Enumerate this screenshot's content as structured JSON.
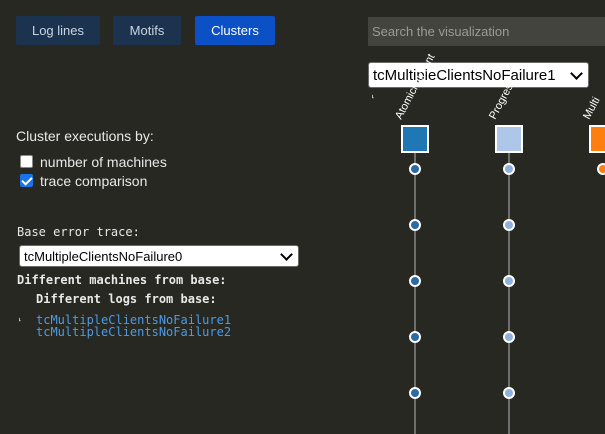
{
  "tabs": [
    {
      "label": "Log lines"
    },
    {
      "label": "Motifs"
    },
    {
      "label": "Clusters"
    }
  ],
  "search": {
    "placeholder": "Search the visualization"
  },
  "viz": {
    "trace_select": "tcMultipleClientsNoFailure1",
    "columns": [
      {
        "label": "AtomicityIntent",
        "color": "#1f77b4",
        "dots": 5
      },
      {
        "label": "Progress",
        "color": "#aec7e8",
        "dots": 5
      },
      {
        "label": "Multi",
        "color": "#ff7f0e",
        "dots": 1
      }
    ],
    "dot_color": "#2a6aa6"
  },
  "left": {
    "cluster_label": "Cluster executions by:",
    "options": [
      {
        "label": "number of machines",
        "checked": false
      },
      {
        "label": "trace comparison",
        "checked": true
      }
    ],
    "base_error_label": "Base error trace:",
    "base_select": "tcMultipleClientsNoFailure0",
    "diff_machines_label": "Different machines from base:",
    "diff_logs_label": "Different logs from base:",
    "links": [
      "tcMultipleClientsNoFailure1",
      "tcMultipleClientsNoFailure2"
    ]
  }
}
